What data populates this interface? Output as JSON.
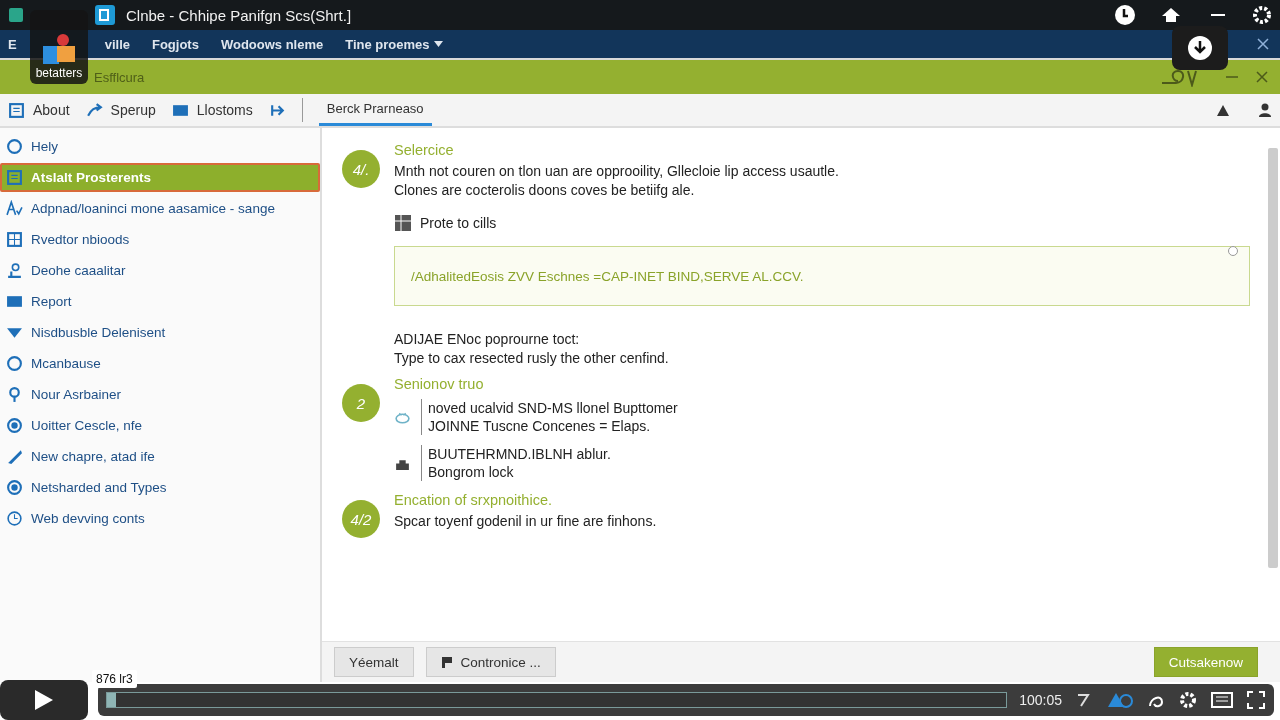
{
  "window": {
    "title": "Clnbe - Chhipe Panifgn Scs(Shrt.]"
  },
  "menu": [
    {
      "label": "E"
    },
    {
      "label": "ville"
    },
    {
      "label": "Fogjots"
    },
    {
      "label": "Wodoows nleme"
    },
    {
      "label": "Tine proemes",
      "dropdown": true
    }
  ],
  "ribbon": {
    "label": "Esfflcura"
  },
  "toolbar": [
    {
      "label": "About"
    },
    {
      "label": "Sperup"
    },
    {
      "label": "Llostoms"
    }
  ],
  "tabs": [
    {
      "label": "Berck Prarneaso",
      "selected": true
    }
  ],
  "sidebar": {
    "items": [
      {
        "label": "Hely",
        "selected": false
      },
      {
        "label": "Atslalt Prosterents",
        "selected": true
      },
      {
        "label": "Adpnad/loaninci mone aasamice - sange",
        "selected": false
      },
      {
        "label": "Rvedtor nbioods",
        "selected": false
      },
      {
        "label": "Deohe caaalitar",
        "selected": false
      },
      {
        "label": "Report",
        "selected": false
      },
      {
        "label": "Nisdbusble Delenisent",
        "selected": false
      },
      {
        "label": "Mcanbause",
        "selected": false
      },
      {
        "label": "Nour Asrbainer",
        "selected": false
      },
      {
        "label": "Uoitter Cescle, nfe",
        "selected": false
      },
      {
        "label": "New chapre, atad ife",
        "selected": false
      },
      {
        "label": "Netsharded and Types",
        "selected": false
      },
      {
        "label": "Web devving conts",
        "selected": false
      }
    ]
  },
  "steps": [
    {
      "badge": "4/.",
      "title": "Selercice",
      "lines": [
        "Mnth not couren on tlon uan are opprooility, Gllecloie lip access usautle.",
        "Clones are cocterolis doons coves be betiifg ale."
      ],
      "link": "Prote to cills",
      "code": "/AdhalitedEosis ZVV Eschnes =CAP-INET BIND,SERVE AL.CCV.",
      "after": [
        "ADIJAE ENoc poprourne toct:",
        "Type to cax resected rusly the other cenfind."
      ]
    },
    {
      "badge": "2",
      "title": "Senionov truo",
      "items": [
        {
          "lines": [
            "noved ucalvid SND-MS llonel Bupttomer",
            "JOINNE Tuscne Concenes = Elaps."
          ]
        },
        {
          "lines": [
            "BUUTEHRMND.IBLNH ablur.",
            "Bongrom lock"
          ]
        }
      ]
    },
    {
      "badge": "4/2",
      "title": "Encation of srxpnoithice.",
      "lines": [
        "Spcar toyenf godenil in ur fine are finhons."
      ]
    }
  ],
  "buttons": [
    {
      "label": "Yéemalt",
      "kind": "plain"
    },
    {
      "label": "Contronice ...",
      "kind": "icon"
    },
    {
      "label": "Cutsakenow",
      "kind": "primary"
    }
  ],
  "player": {
    "channel": "betatters",
    "tooltip": "876 lr3",
    "time": "100:05",
    "level": 0.01
  }
}
